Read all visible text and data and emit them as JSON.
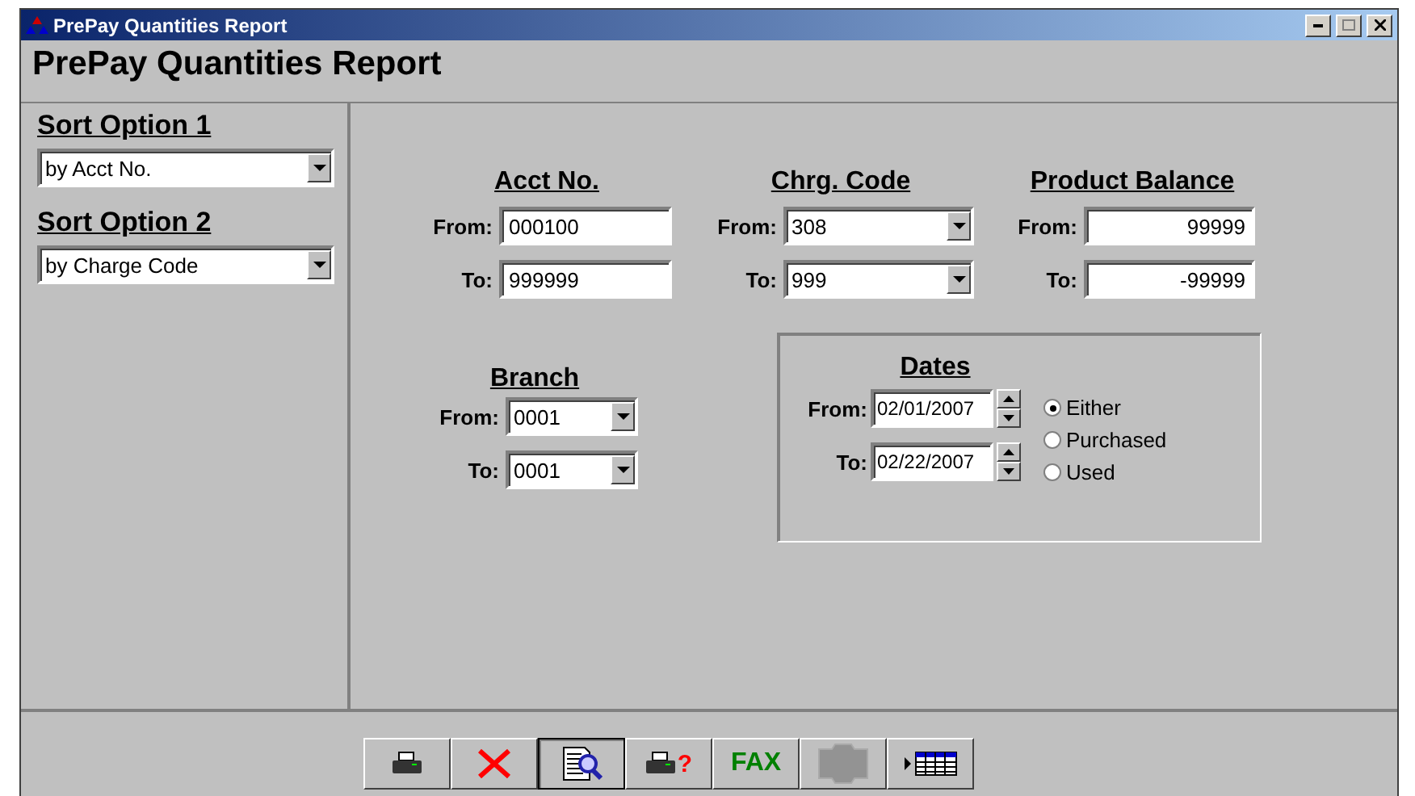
{
  "window": {
    "title": "PrePay Quantities Report"
  },
  "heading": "PrePay Quantities Report",
  "sort_options": [
    {
      "label": "Sort Option 1",
      "value": "by Acct No."
    },
    {
      "label": "Sort Option 2",
      "value": "by Charge Code"
    }
  ],
  "ranges": [
    {
      "title": "Acct No.",
      "kind": "text",
      "from_label": "From:",
      "to_label": "To:",
      "from": "000100",
      "to": "999999"
    },
    {
      "title": "Chrg. Code",
      "kind": "combo",
      "from_label": "From:",
      "to_label": "To:",
      "from": "308",
      "to": "999"
    },
    {
      "title": "Product Balance",
      "kind": "number",
      "from_label": "From:",
      "to_label": "To:",
      "from": "99999",
      "to": "-99999"
    }
  ],
  "branch": {
    "title": "Branch",
    "from_label": "From:",
    "to_label": "To:",
    "from": "0001",
    "to": "0001"
  },
  "dates": {
    "title": "Dates",
    "from_label": "From:",
    "to_label": "To:",
    "from": "02/01/2007",
    "to": "02/22/2007",
    "options": [
      {
        "label": "Either",
        "selected": true
      },
      {
        "label": "Purchased",
        "selected": false
      },
      {
        "label": "Used",
        "selected": false
      }
    ]
  },
  "toolbar": [
    {
      "kind": "print",
      "selected": false,
      "disabled": false
    },
    {
      "kind": "cancel",
      "selected": false,
      "disabled": false
    },
    {
      "kind": "preview",
      "selected": true,
      "disabled": false
    },
    {
      "kind": "print-setup",
      "label": "?",
      "selected": false,
      "disabled": false
    },
    {
      "kind": "fax",
      "label": "FAX",
      "selected": false,
      "disabled": false
    },
    {
      "kind": "scan",
      "selected": false,
      "disabled": true
    },
    {
      "kind": "grid",
      "selected": false,
      "disabled": false
    }
  ]
}
